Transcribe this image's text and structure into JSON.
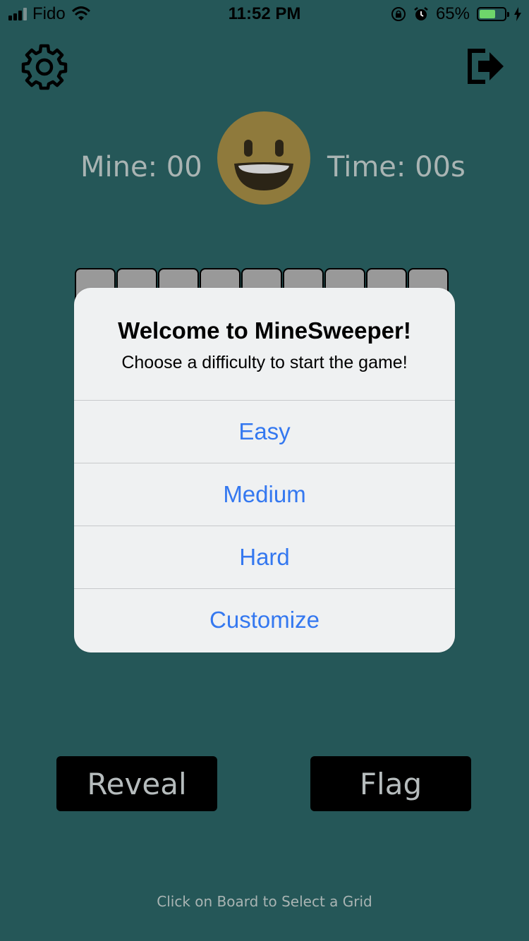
{
  "status_bar": {
    "carrier": "Fido",
    "time": "11:52 PM",
    "battery_percent": "65%",
    "battery_level": 0.65,
    "icons": [
      "cellular-signal-icon",
      "wifi-icon",
      "orientation-lock-icon",
      "alarm-icon",
      "battery-icon",
      "charging-icon"
    ]
  },
  "header": {
    "mine_label": "Mine: 00",
    "time_label": "Time: 00s",
    "face": "smiley-face-icon"
  },
  "toolbar": {
    "settings_icon": "gear-icon",
    "exit_icon": "exit-icon"
  },
  "board": {
    "visible_columns": 9
  },
  "dialog": {
    "title": "Welcome to MineSweeper!",
    "message": "Choose a difficulty to start the game!",
    "options": [
      "Easy",
      "Medium",
      "Hard",
      "Customize"
    ]
  },
  "actions": {
    "reveal_label": "Reveal",
    "flag_label": "Flag"
  },
  "hint": "Click on Board to Select a Grid",
  "colors": {
    "background": "#255758",
    "dialog_background": "#eff1f2",
    "option_text": "#3478f0",
    "counter_text": "#a9b4b3",
    "cell": "#999999",
    "smiley": "#8f7a3c"
  }
}
